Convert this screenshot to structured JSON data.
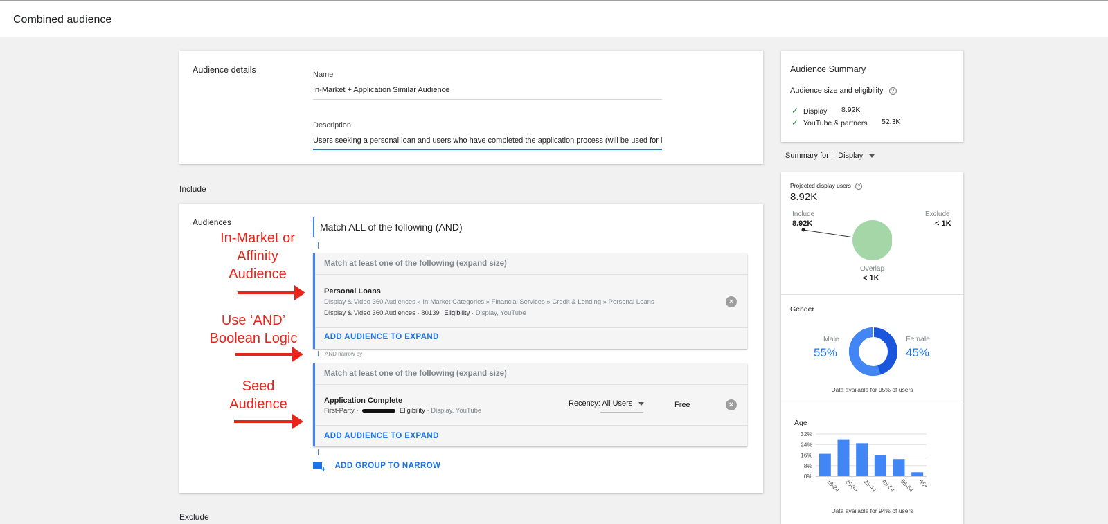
{
  "header": {
    "title": "Combined audience"
  },
  "details": {
    "section_label": "Audience details",
    "name_label": "Name",
    "name_value": "In-Market + Application Similar Audience",
    "description_label": "Description",
    "description_value": "Users seeking a personal loan and users who have completed the application process (will be used for lool"
  },
  "include": {
    "section_label": "Include",
    "audiences_label": "Audiences",
    "match_all": "Match ALL of the following (AND)",
    "group1": {
      "header": "Match at least one of the following (expand size)",
      "item_title": "Personal Loans",
      "item_path": "Display & Video 360 Audiences » In-Market Categories » Financial Services » Credit & Lending » Personal Loans",
      "item_meta_source": "Display & Video 360 Audiences · 80139",
      "item_meta_eligibility_label": "Eligibility",
      "item_meta_eligibility_value": "· Display, YouTube",
      "add_label": "ADD AUDIENCE TO EXPAND"
    },
    "and_narrow": "AND narrow by",
    "group2": {
      "header": "Match at least one of the following (expand size)",
      "item_title": "Application Complete",
      "item_meta_source": "First-Party ·",
      "item_meta_eligibility_label": "Eligibility",
      "item_meta_eligibility_value": "· Display, YouTube",
      "recency_label": "Recency:",
      "recency_value": "All Users",
      "price": "Free",
      "add_label": "ADD AUDIENCE TO EXPAND"
    },
    "add_group": "ADD GROUP TO NARROW"
  },
  "exclude": {
    "section_label": "Exclude"
  },
  "annotations": {
    "a1": [
      "In-Market or",
      "Affinity",
      "Audience"
    ],
    "a2": [
      "Use ‘AND’",
      "Boolean Logic"
    ],
    "a3": [
      "Seed",
      "Audience"
    ]
  },
  "summary": {
    "title": "Audience Summary",
    "size_label": "Audience size and eligibility",
    "rows": [
      {
        "name": "Display",
        "value": "8.92K"
      },
      {
        "name": "YouTube & partners",
        "value": "52.3K"
      }
    ],
    "summary_for_label": "Summary for :",
    "summary_for_value": "Display"
  },
  "projected": {
    "label": "Projected display users",
    "value": "8.92K",
    "include_label": "Include",
    "include_value": "8.92K",
    "exclude_label": "Exclude",
    "exclude_value": "< 1K",
    "overlap_label": "Overlap",
    "overlap_value": "< 1K"
  },
  "gender": {
    "title": "Gender",
    "male_label": "Male",
    "male_value": "55%",
    "female_label": "Female",
    "female_value": "45%",
    "male_fraction": 0.55,
    "note": "Data available for 95% of users"
  },
  "chart_data": {
    "type": "bar",
    "title": "Age",
    "categories": [
      "18-24",
      "25-34",
      "35-44",
      "45-54",
      "55-64",
      "65+"
    ],
    "values": [
      17,
      28,
      25,
      16,
      13,
      3
    ],
    "yticks": [
      "32%",
      "24%",
      "16%",
      "8%",
      "0%"
    ],
    "ylim": [
      0,
      32
    ],
    "grid": true,
    "note": "Data available for 94% of users",
    "bar_color": "#4285f4"
  },
  "colors": {
    "accent": "#1a73e8",
    "annotation": "#e8241b",
    "overlap": "#a5d6a7"
  }
}
